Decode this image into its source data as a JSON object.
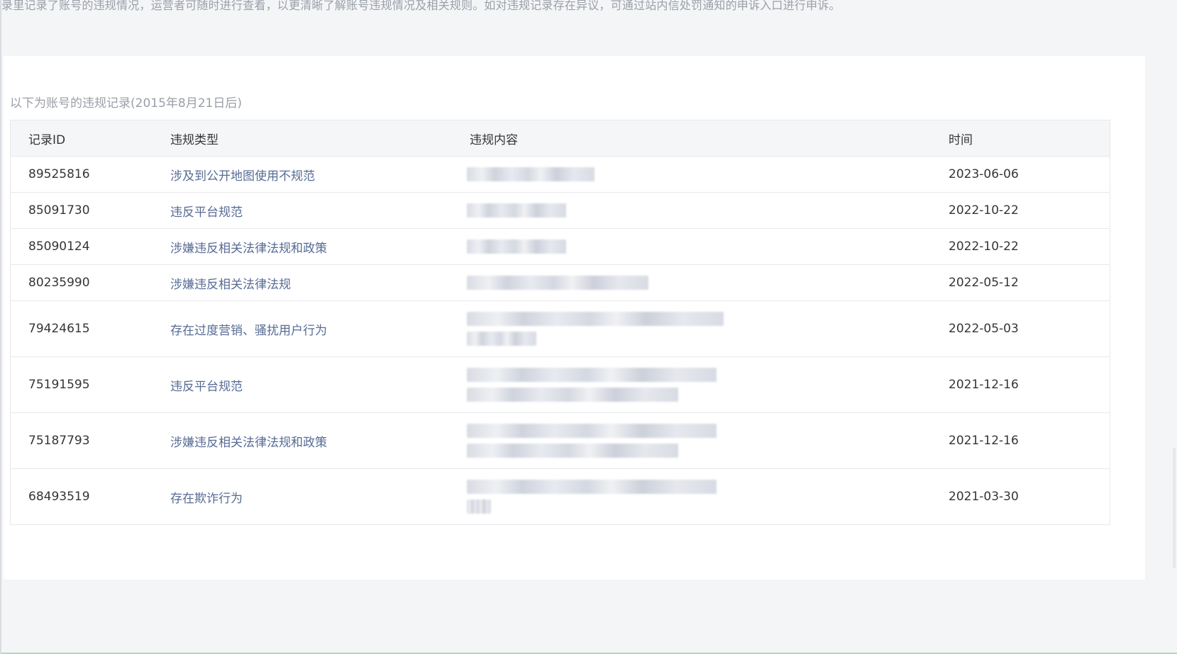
{
  "notice_text": "录里记录了账号的违规情况，运营者可随时进行查看，以更清晰了解账号违规情况及相关规则。如对违规记录存在异议，可通过站内信处罚通知的申诉入口进行申诉。",
  "subtitle": "以下为账号的违规记录(2015年8月21日后)",
  "table": {
    "headers": {
      "id": "记录ID",
      "type": "违规类型",
      "content": "违规内容",
      "time": "时间"
    },
    "rows": [
      {
        "id": "89525816",
        "type": "涉及到公开地图使用不规范",
        "time": "2023-06-06"
      },
      {
        "id": "85091730",
        "type": "违反平台规范",
        "time": "2022-10-22"
      },
      {
        "id": "85090124",
        "type": "涉嫌违反相关法律法规和政策",
        "time": "2022-10-22"
      },
      {
        "id": "80235990",
        "type": "涉嫌违反相关法律法规",
        "time": "2022-05-12"
      },
      {
        "id": "79424615",
        "type": "存在过度营销、骚扰用户行为",
        "time": "2022-05-03"
      },
      {
        "id": "75191595",
        "type": "违反平台规范",
        "time": "2021-12-16"
      },
      {
        "id": "75187793",
        "type": "涉嫌违反相关法律法规和政策",
        "time": "2021-12-16"
      },
      {
        "id": "68493519",
        "type": "存在欺诈行为",
        "time": "2021-03-30"
      }
    ]
  },
  "colors": {
    "link": "#576b95",
    "text": "#353535",
    "muted": "#9a9ea6",
    "header_bg": "#f5f6f8",
    "border": "#e7e8eb"
  }
}
